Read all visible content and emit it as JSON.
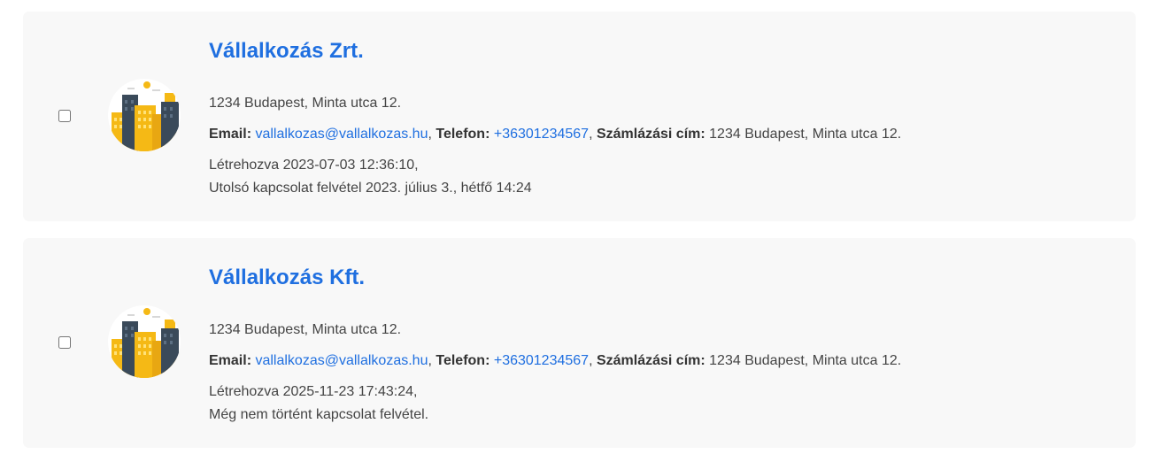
{
  "companies": [
    {
      "name": "Vállalkozás Zrt.",
      "address": "1234 Budapest, Minta utca 12.",
      "email_label": "Email:",
      "email": "vallalkozas@vallalkozas.hu",
      "phone_label": "Telefon:",
      "phone": "+36301234567",
      "billing_label": "Számlázási cím:",
      "billing_address": "1234 Budapest, Minta utca 12.",
      "created": "Létrehozva 2023-07-03 12:36:10,",
      "last_contact": "Utolsó kapcsolat felvétel 2023. július 3., hétfő 14:24",
      "avatar_icon": "city-buildings-icon",
      "checked": false
    },
    {
      "name": "Vállalkozás Kft.",
      "address": "1234 Budapest, Minta utca 12.",
      "email_label": "Email:",
      "email": "vallalkozas@vallalkozas.hu",
      "phone_label": "Telefon:",
      "phone": "+36301234567",
      "billing_label": "Számlázási cím:",
      "billing_address": "1234 Budapest, Minta utca 12.",
      "created": "Létrehozva 2025-11-23 17:43:24,",
      "last_contact": "Még nem történt kapcsolat felvétel.",
      "avatar_icon": "city-buildings-icon",
      "checked": false
    }
  ],
  "colors": {
    "link": "#1f6fe0",
    "card_background": "#f8f8f8",
    "building_yellow": "#f5b915",
    "building_dark": "#3a4a5a"
  }
}
